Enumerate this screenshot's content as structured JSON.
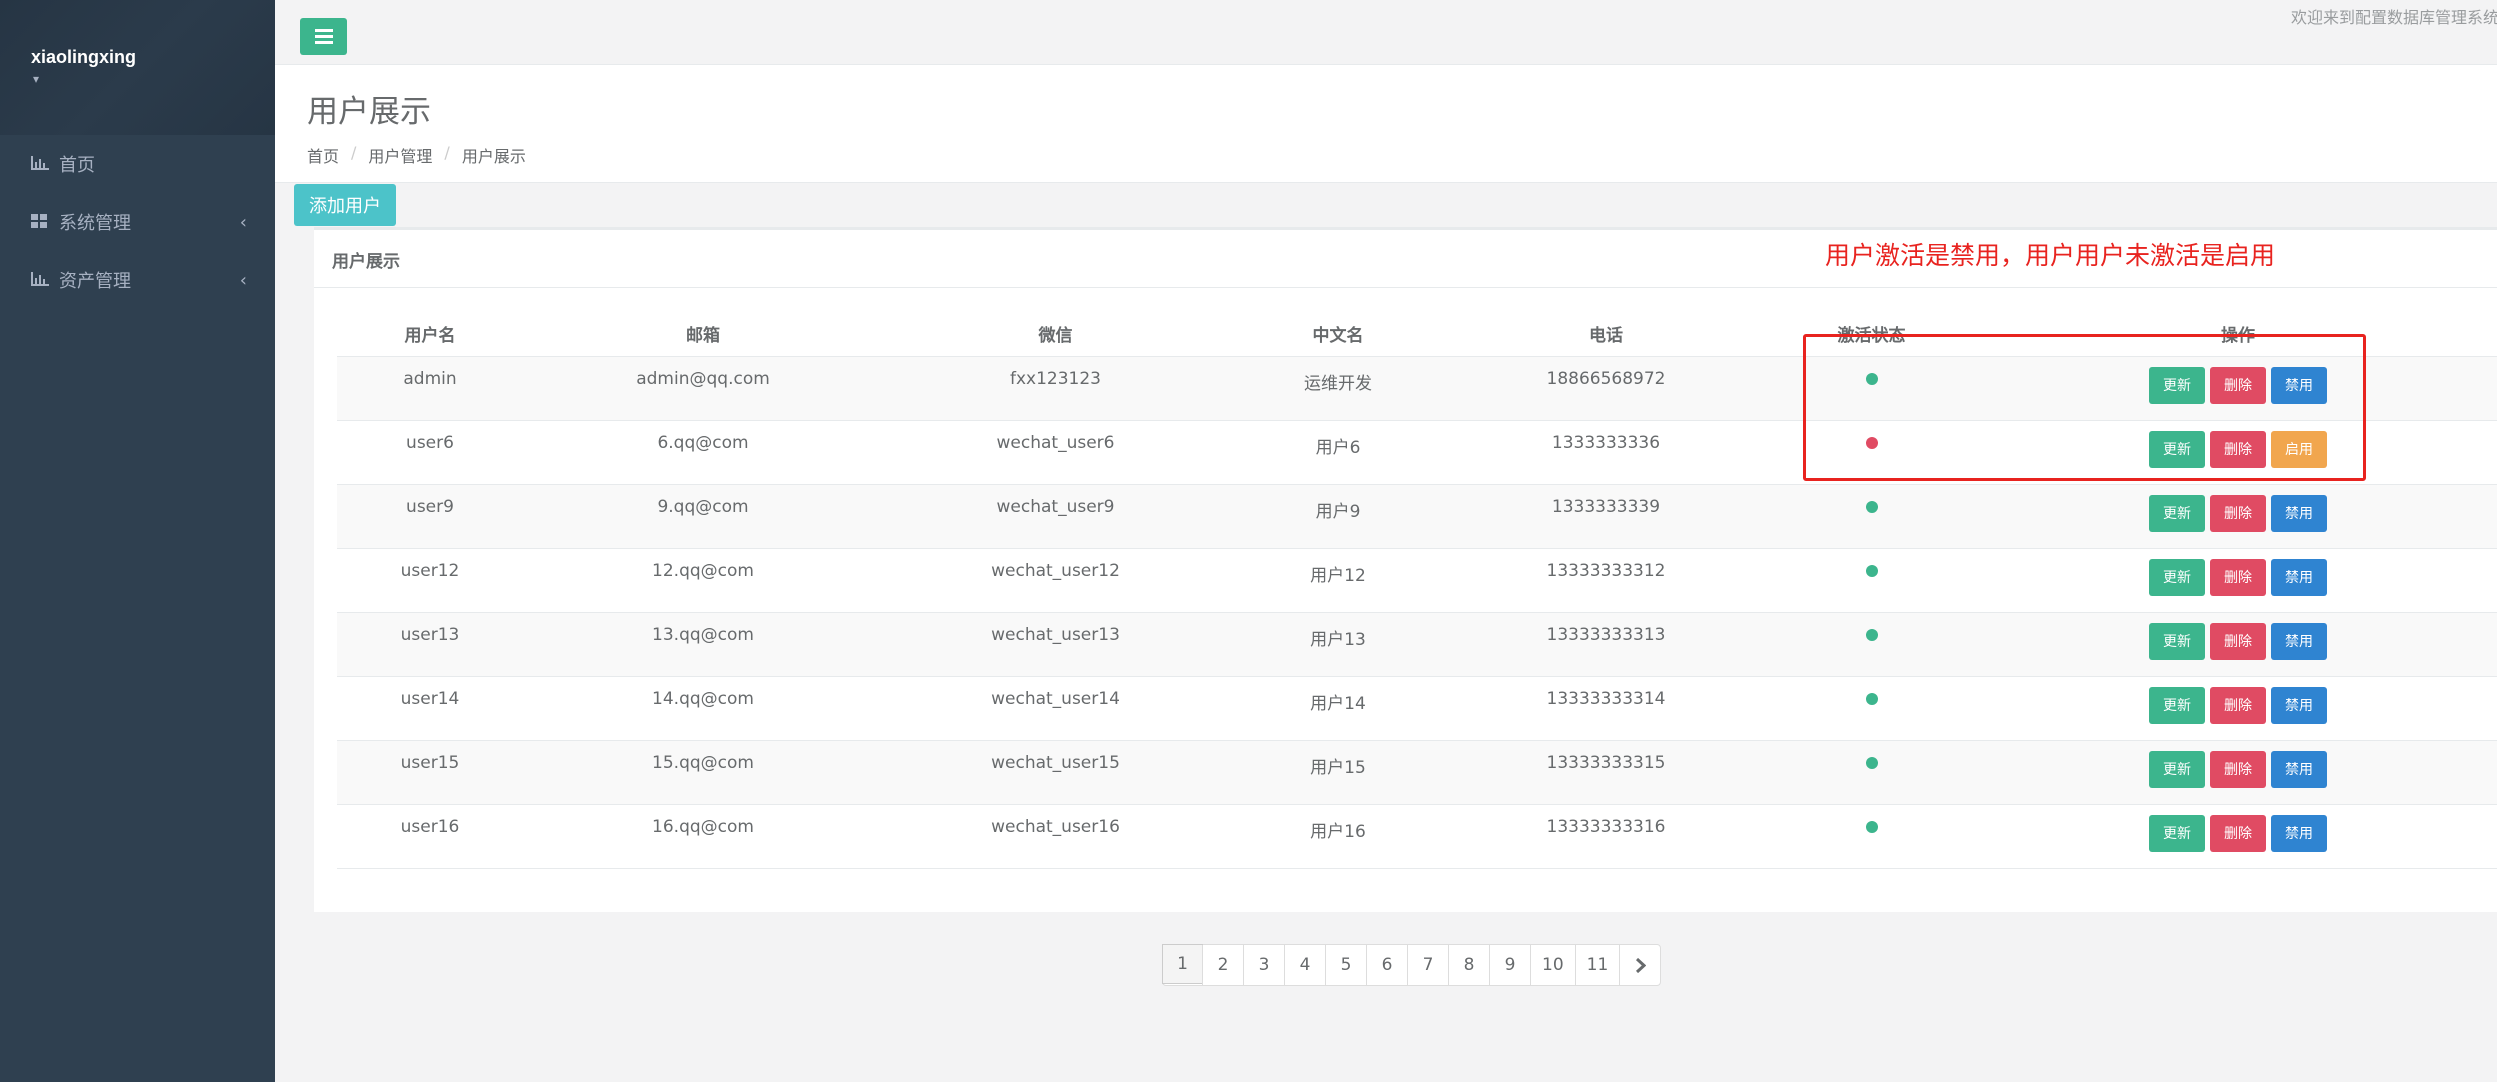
{
  "sidebar": {
    "username": "xiaolingxing",
    "items": [
      {
        "label": "首页",
        "icon": "bar-chart-icon",
        "has_arrow": false
      },
      {
        "label": "系统管理",
        "icon": "grid-icon",
        "has_arrow": true
      },
      {
        "label": "资产管理",
        "icon": "bar-chart-icon",
        "has_arrow": true
      }
    ]
  },
  "topbar": {
    "welcome": "欢迎来到配置数据库管理系统"
  },
  "heading": {
    "title": "用户展示",
    "breadcrumb": [
      "首页",
      "用户管理",
      "用户展示"
    ]
  },
  "toolbar": {
    "add_label": "添加用户"
  },
  "panel": {
    "title": "用户展示"
  },
  "annotation": {
    "text": "用户激活是禁用，用户用户未激活是启用",
    "color": "#e8231f"
  },
  "table": {
    "headers": [
      "用户名",
      "邮箱",
      "微信",
      "中文名",
      "电话",
      "激活状态",
      "操作"
    ],
    "rows": [
      {
        "username": "admin",
        "email": "admin@qq.com",
        "wechat": "fxx123123",
        "cn_name": "运维开发",
        "phone": "18866568972",
        "active": true,
        "toggle": "禁用"
      },
      {
        "username": "user6",
        "email": "6.qq@com",
        "wechat": "wechat_user6",
        "cn_name": "用户6",
        "phone": "1333333336",
        "active": false,
        "toggle": "启用"
      },
      {
        "username": "user9",
        "email": "9.qq@com",
        "wechat": "wechat_user9",
        "cn_name": "用户9",
        "phone": "1333333339",
        "active": true,
        "toggle": "禁用"
      },
      {
        "username": "user12",
        "email": "12.qq@com",
        "wechat": "wechat_user12",
        "cn_name": "用户12",
        "phone": "13333333312",
        "active": true,
        "toggle": "禁用"
      },
      {
        "username": "user13",
        "email": "13.qq@com",
        "wechat": "wechat_user13",
        "cn_name": "用户13",
        "phone": "13333333313",
        "active": true,
        "toggle": "禁用"
      },
      {
        "username": "user14",
        "email": "14.qq@com",
        "wechat": "wechat_user14",
        "cn_name": "用户14",
        "phone": "13333333314",
        "active": true,
        "toggle": "禁用"
      },
      {
        "username": "user15",
        "email": "15.qq@com",
        "wechat": "wechat_user15",
        "cn_name": "用户15",
        "phone": "13333333315",
        "active": true,
        "toggle": "禁用"
      },
      {
        "username": "user16",
        "email": "16.qq@com",
        "wechat": "wechat_user16",
        "cn_name": "用户16",
        "phone": "13333333316",
        "active": true,
        "toggle": "禁用"
      }
    ],
    "update_label": "更新",
    "delete_label": "删除"
  },
  "pagination": {
    "pages": [
      "1",
      "2",
      "3",
      "4",
      "5",
      "6",
      "7",
      "8",
      "9",
      "10",
      "11"
    ],
    "current": "1"
  },
  "colors": {
    "active_dot": "#3cb58d",
    "inactive_dot": "#e04b63",
    "enable_button": "#f1a64e",
    "disable_button": "#2f84d1"
  }
}
